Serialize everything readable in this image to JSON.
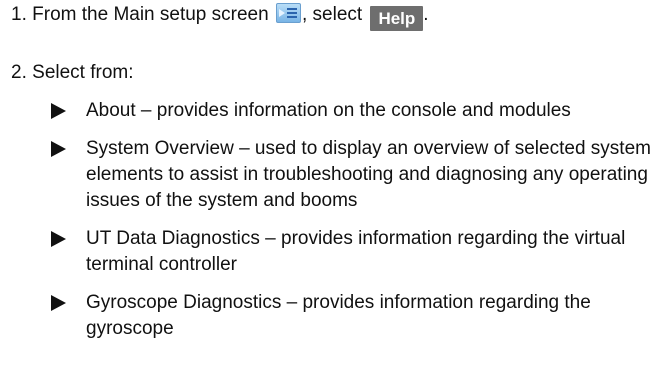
{
  "step1": {
    "number": "1.",
    "text_before": "From the Main setup screen",
    "icon": "main-setup-icon",
    "text_middle": ", select",
    "button_label": "Help",
    "text_after": "."
  },
  "step2": {
    "number": "2.",
    "text": "Select from:"
  },
  "options": [
    {
      "text": "About – provides information on the console and modules"
    },
    {
      "text": "System Overview – used to display an overview of selected system elements to assist in troubleshooting and diagnosing any operating issues of the system and booms"
    },
    {
      "text": "UT Data Diagnostics – provides information regarding the virtual terminal controller"
    },
    {
      "text": "Gyroscope Diagnostics – provides information regarding the gyroscope"
    }
  ],
  "colors": {
    "help_button_bg": "#6e6e6e",
    "help_button_text": "#ffffff",
    "icon_blue": "#78b4e6"
  }
}
